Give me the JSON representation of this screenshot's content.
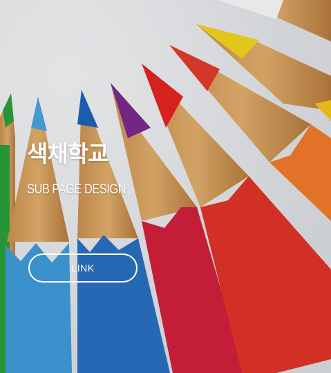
{
  "hero": {
    "title": "색채학교",
    "subtitle": "SUB PAGE DESIGN",
    "button_label": "LINK"
  },
  "background": {
    "image": "colored-pencils-photo",
    "paper_color": "#e9ebee",
    "pencil_colors": [
      "#2a9e3a",
      "#4aa3dc",
      "#1f6fc4",
      "#7a2a8c",
      "#d8263a",
      "#e23b2c",
      "#f28a2a",
      "#f2d31c",
      "#f5f5f5"
    ]
  }
}
